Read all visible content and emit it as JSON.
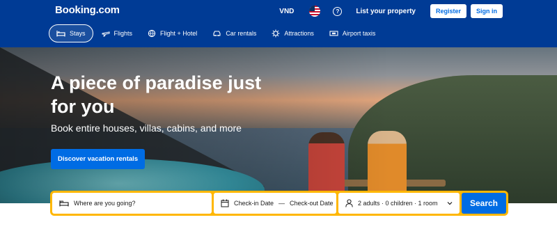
{
  "header": {
    "logo": "Booking.com",
    "currency": "VND",
    "help_icon": "?",
    "list_property": "List your property",
    "register": "Register",
    "sign_in": "Sign in"
  },
  "nav": {
    "items": [
      {
        "label": "Stays",
        "icon": "bed-icon"
      },
      {
        "label": "Flights",
        "icon": "plane-icon"
      },
      {
        "label": "Flight + Hotel",
        "icon": "globe-plane-icon"
      },
      {
        "label": "Car rentals",
        "icon": "car-icon"
      },
      {
        "label": "Attractions",
        "icon": "attractions-icon"
      },
      {
        "label": "Airport taxis",
        "icon": "taxi-icon"
      }
    ]
  },
  "hero": {
    "title": "A piece of paradise just for you",
    "subtitle": "Book entire houses, villas, cabins, and more",
    "cta": "Discover vacation rentals"
  },
  "search": {
    "destination_placeholder": "Where are you going?",
    "checkin": "Check-in Date",
    "separator": "—",
    "checkout": "Check-out Date",
    "occupancy": "2 adults · 0 children · 1 room",
    "button": "Search"
  },
  "colors": {
    "brand_blue": "#003b95",
    "action_blue": "#006ce4",
    "search_border": "#ffb700"
  }
}
